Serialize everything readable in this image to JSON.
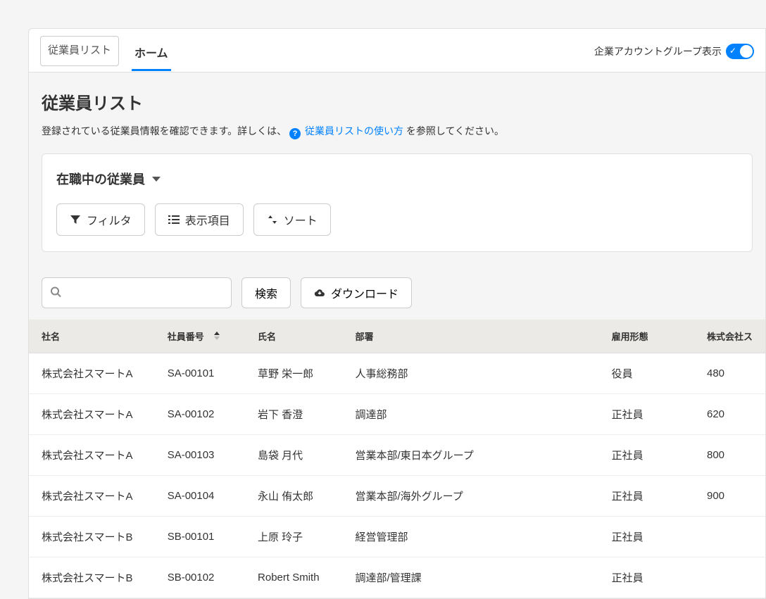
{
  "tabs": {
    "list_tab": "従業員リスト",
    "home_tab": "ホーム"
  },
  "header": {
    "toggle_label": "企業アカウントグループ表示"
  },
  "page": {
    "title": "従業員リスト",
    "desc_pre": "登録されている従業員情報を確認できます。詳しくは、",
    "desc_link": "従業員リストの使い方",
    "desc_post": " を参照してください。"
  },
  "filter": {
    "status": "在職中の従業員",
    "filter_btn": "フィルタ",
    "columns_btn": "表示項目",
    "sort_btn": "ソート"
  },
  "search": {
    "search_btn": "検索",
    "download_btn": "ダウンロード",
    "placeholder": ""
  },
  "table": {
    "headers": {
      "company": "社名",
      "emp_id": "社員番号",
      "name": "氏名",
      "dept": "部署",
      "emp_type": "雇用形態",
      "extra": "株式会社ス"
    },
    "rows": [
      {
        "company": "株式会社スマートA",
        "emp_id": "SA-00101",
        "name": "草野 栄一郎",
        "dept": "人事総務部",
        "emp_type": "役員",
        "extra": "480"
      },
      {
        "company": "株式会社スマートA",
        "emp_id": "SA-00102",
        "name": "岩下 香澄",
        "dept": "調達部",
        "emp_type": "正社員",
        "extra": "620"
      },
      {
        "company": "株式会社スマートA",
        "emp_id": "SA-00103",
        "name": "島袋 月代",
        "dept": "営業本部/東日本グループ",
        "emp_type": "正社員",
        "extra": "800"
      },
      {
        "company": "株式会社スマートA",
        "emp_id": "SA-00104",
        "name": "永山 侑太郎",
        "dept": "営業本部/海外グループ",
        "emp_type": "正社員",
        "extra": "900"
      },
      {
        "company": "株式会社スマートB",
        "emp_id": "SB-00101",
        "name": "上原 玲子",
        "dept": "経営管理部",
        "emp_type": "正社員",
        "extra": ""
      },
      {
        "company": "株式会社スマートB",
        "emp_id": "SB-00102",
        "name": "Robert Smith",
        "dept": "調達部/管理課",
        "emp_type": "正社員",
        "extra": ""
      }
    ]
  }
}
